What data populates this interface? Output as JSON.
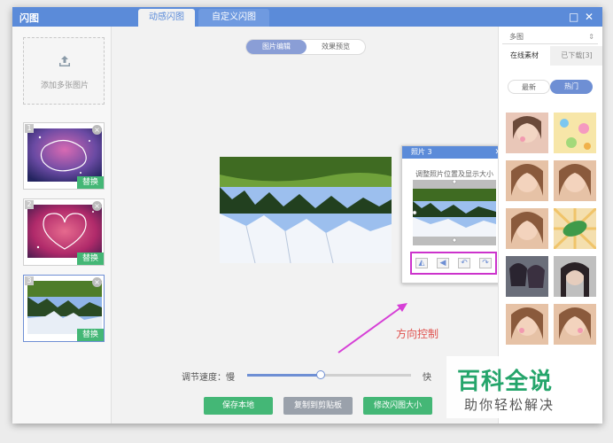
{
  "app": {
    "title": "闪图",
    "tabs": [
      {
        "label": "动感闪图",
        "active": true
      },
      {
        "label": "自定义闪图",
        "active": false
      }
    ],
    "window_controls": [
      "□",
      "✕"
    ]
  },
  "left_panel": {
    "add_label": "添加多张图片",
    "thumbnails": [
      {
        "index": "1",
        "replace_label": "替换",
        "selected": false
      },
      {
        "index": "2",
        "replace_label": "替换",
        "selected": false
      },
      {
        "index": "3",
        "replace_label": "替换",
        "selected": true
      }
    ]
  },
  "center": {
    "segments": [
      "图片编辑",
      "效果预览"
    ],
    "speed": {
      "label": "调节速度：慢",
      "fast_label": "快",
      "value": 0.45
    },
    "buttons": [
      "保存本地",
      "复制到剪贴板",
      "修改闪图大小"
    ],
    "annotation": "方向控制"
  },
  "popup": {
    "title": "照片 3",
    "close": "✕",
    "description": "调整照片位置及显示大小",
    "direction_icons": [
      "flip-horizontal-icon",
      "flip-vertical-icon",
      "rotate-left-icon",
      "rotate-right-icon"
    ]
  },
  "right_panel": {
    "select_value": "多图",
    "tabs": [
      "在线素材",
      "已下载[3]"
    ],
    "filters": [
      "最新",
      "热门"
    ],
    "active_filter": "热门"
  },
  "watermark": {
    "brand": "百科全说",
    "tagline": "助你轻松解决"
  },
  "colors": {
    "accent": "#5b8bd9",
    "green": "#44b776",
    "highlight": "#cc33cc",
    "annotation": "#e0524f"
  }
}
